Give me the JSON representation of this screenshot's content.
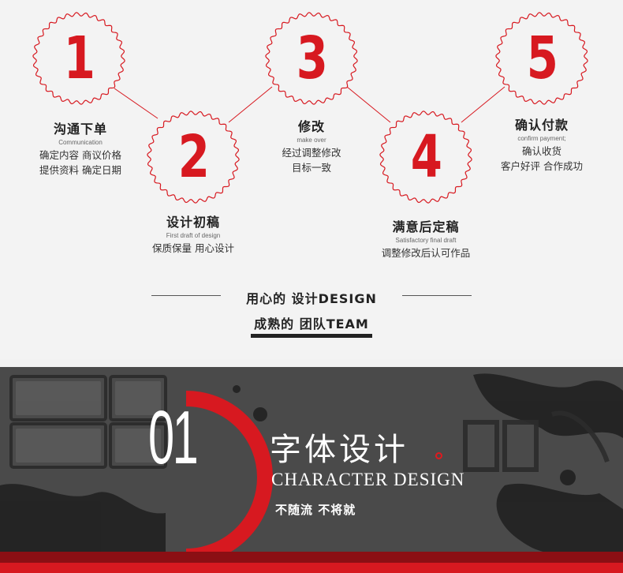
{
  "steps": [
    {
      "number": "1",
      "title": "沟通下单",
      "subtitle": "Communication",
      "desc": [
        "确定内容 商议价格",
        "提供资料 确定日期"
      ]
    },
    {
      "number": "2",
      "title": "设计初稿",
      "subtitle": "First draft of design",
      "desc": [
        "保质保量 用心设计"
      ]
    },
    {
      "number": "3",
      "title": "修改",
      "subtitle": "make over",
      "desc": [
        "经过调整修改",
        "目标一致"
      ]
    },
    {
      "number": "4",
      "title": "满意后定稿",
      "subtitle": "Satisfactory final draft",
      "desc": [
        "调整修改后认可作品"
      ]
    },
    {
      "number": "5",
      "title": "确认付款",
      "subtitle": "confirm payment;",
      "desc": [
        "确认收货",
        "客户好评 合作成功"
      ]
    }
  ],
  "slogan": {
    "line1": "用心的 设计DESIGN",
    "line2": "成熟的 团队TEAM"
  },
  "banner": {
    "number": "01",
    "title_cn": "字体设计",
    "title_en": "CHARACTER DESIGN",
    "tagline": "不随流 不将就"
  },
  "colors": {
    "accent": "#d71920",
    "dark_red": "#8b0f14",
    "banner_bg": "#4a4a4a"
  }
}
